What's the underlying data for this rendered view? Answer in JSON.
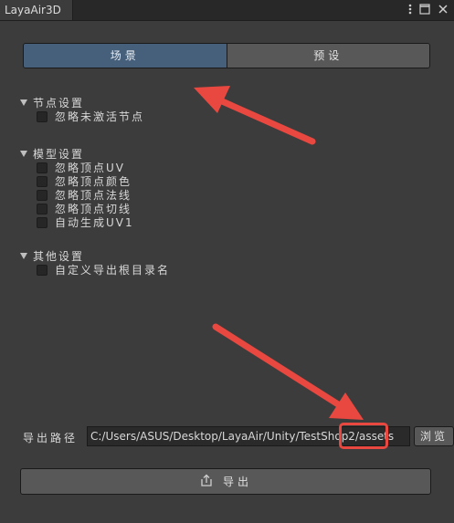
{
  "window": {
    "tab_title": "LayaAir3D"
  },
  "segments": {
    "scene_label": "场景",
    "preset_label": "预设"
  },
  "groups": [
    {
      "title": "节点设置",
      "options": [
        "忽略未激活节点"
      ]
    },
    {
      "title": "模型设置",
      "options": [
        "忽略顶点UV",
        "忽略顶点颜色",
        "忽略顶点法线",
        "忽略顶点切线",
        "自动生成UV1"
      ]
    },
    {
      "title": "其他设置",
      "options": [
        "自定义导出根目录名"
      ]
    }
  ],
  "export_path": {
    "label": "导出路径",
    "value": "C:/Users/ASUS/Desktop/LayaAir/Unity/TestShop2/assets",
    "browse_label": "浏览"
  },
  "export_button": {
    "label": "导出",
    "icon": "export-icon"
  },
  "colors": {
    "annotation_red": "#e8483f",
    "active_segment": "#46607c"
  }
}
